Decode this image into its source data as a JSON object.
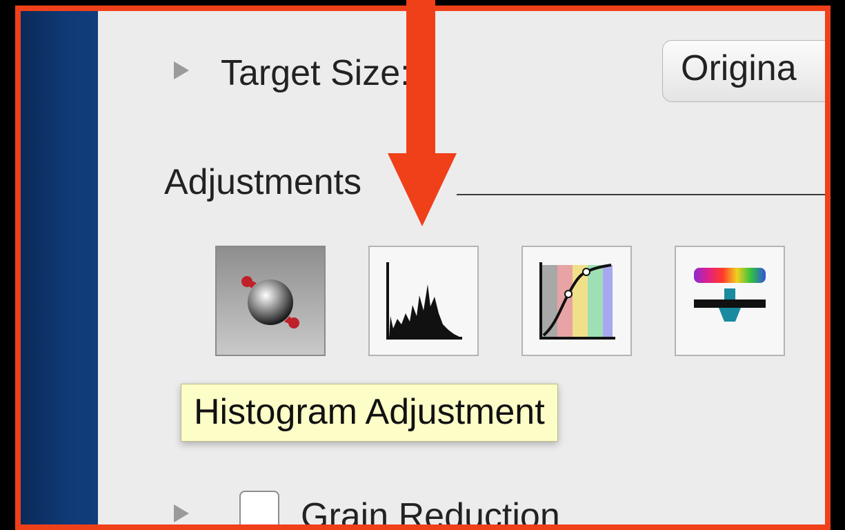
{
  "target_size": {
    "label": "Target Size:",
    "value": "Origina"
  },
  "adjustments": {
    "section_label": "Adjustments",
    "tools": [
      {
        "id": "color-balance",
        "icon": "color-balance-icon",
        "selected": true
      },
      {
        "id": "histogram",
        "icon": "histogram-icon",
        "selected": false
      },
      {
        "id": "curves",
        "icon": "curves-icon",
        "selected": false
      },
      {
        "id": "selective-color",
        "icon": "selective-color-icon",
        "selected": false
      }
    ]
  },
  "tooltip": {
    "text": "Histogram Adjustment"
  },
  "grain_reduction": {
    "label": "Grain Reduction",
    "checked": false
  },
  "colors": {
    "highlight_border": "#f0401a",
    "arrow": "#f0401a",
    "tooltip_bg": "#fdfdc8"
  }
}
